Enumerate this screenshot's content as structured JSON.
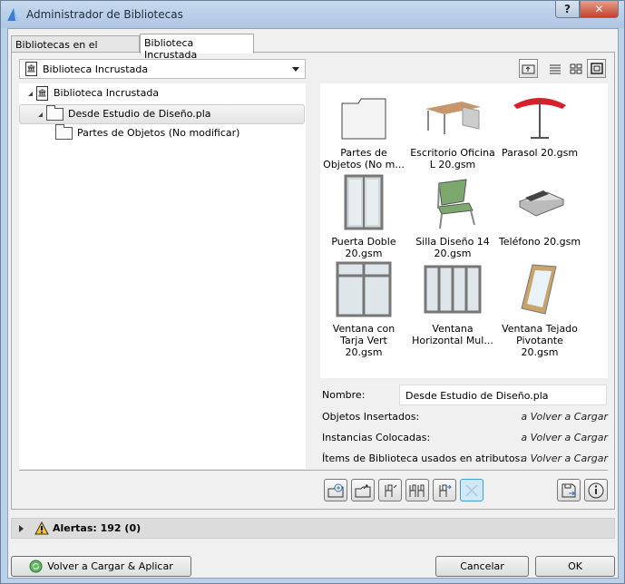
{
  "window": {
    "title": "Administrador de Bibliotecas",
    "help": "?",
    "close": "✕"
  },
  "tabs": [
    {
      "label": "Bibliotecas en el Proyecto"
    },
    {
      "label": "Biblioteca Incrustada"
    }
  ],
  "dropdown": {
    "value": "Biblioteca Incrustada"
  },
  "tree": [
    {
      "label": "Biblioteca Incrustada"
    },
    {
      "label": "Desde Estudio de Diseño.pla"
    },
    {
      "label": "Partes de Objetos (No modificar)"
    }
  ],
  "grid": [
    {
      "line1": "Partes de",
      "line2": "Objetos (No m..."
    },
    {
      "line1": "Escritorio Oficina",
      "line2": "L 20.gsm"
    },
    {
      "line1": "Parasol 20.gsm",
      "line2": ""
    },
    {
      "line1": "Puerta Doble",
      "line2": "20.gsm"
    },
    {
      "line1": "Silla Diseño 14",
      "line2": "20.gsm"
    },
    {
      "line1": "Teléfono 20.gsm",
      "line2": ""
    },
    {
      "line1": "Ventana con",
      "line2": "Tarja Vert 20.gsm"
    },
    {
      "line1": "Ventana",
      "line2": "Horizontal Mul..."
    },
    {
      "line1": "Ventana Tejado",
      "line2": "Pivotante 20.gsm"
    }
  ],
  "info": {
    "name_label": "Nombre:",
    "name_value": "Desde Estudio de Diseño.pla",
    "rows": [
      {
        "label": "Objetos Insertados:",
        "value": "a Volver a Cargar"
      },
      {
        "label": "Instancias Colocadas:",
        "value": "a Volver a Cargar"
      },
      {
        "label": "Ítems de Biblioteca usados en atributos:",
        "value": "a Volver a Cargar"
      }
    ]
  },
  "alerts": {
    "label": "Alertas: 192 (0)"
  },
  "footer": {
    "reload": "Volver a Cargar & Aplicar",
    "cancel": "Cancelar",
    "ok": "OK"
  }
}
